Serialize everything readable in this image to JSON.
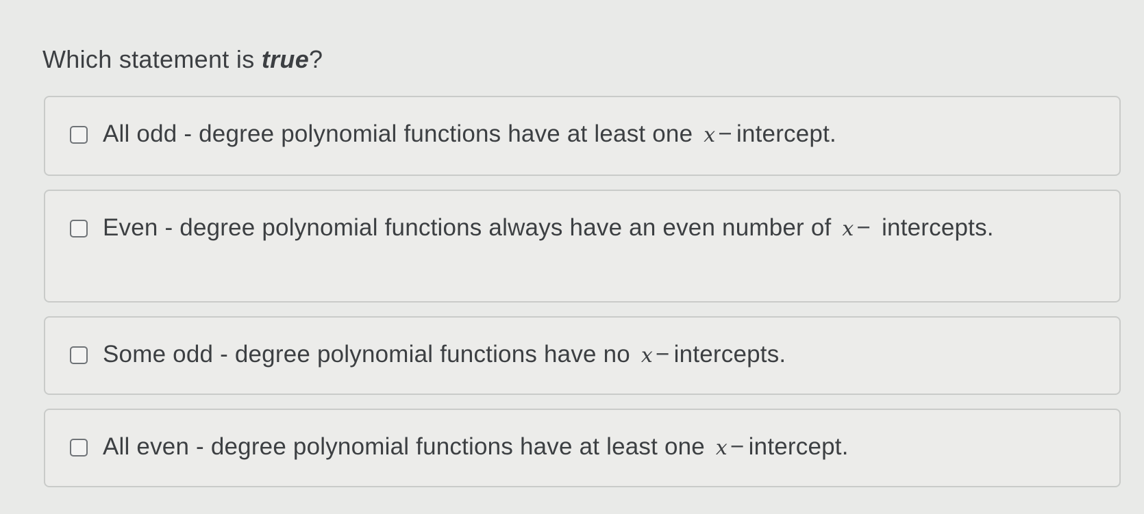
{
  "question": {
    "prefix": "Which statement is ",
    "emphasis": "true",
    "suffix": "?"
  },
  "options": [
    {
      "before": "All odd - degree polynomial functions have at least one",
      "variable": "x",
      "dash": "−",
      "after": "intercept.",
      "checked": false
    },
    {
      "before": "Even - degree polynomial functions always have an even number of",
      "variable": "x",
      "dash": "−",
      "after": "intercepts.",
      "checked": false
    },
    {
      "before": "Some odd - degree polynomial functions have no",
      "variable": "x",
      "dash": "−",
      "after": "intercepts.",
      "checked": false
    },
    {
      "before": "All even - degree polynomial functions have at least one",
      "variable": "x",
      "dash": "−",
      "after": "intercept.",
      "checked": false
    }
  ]
}
